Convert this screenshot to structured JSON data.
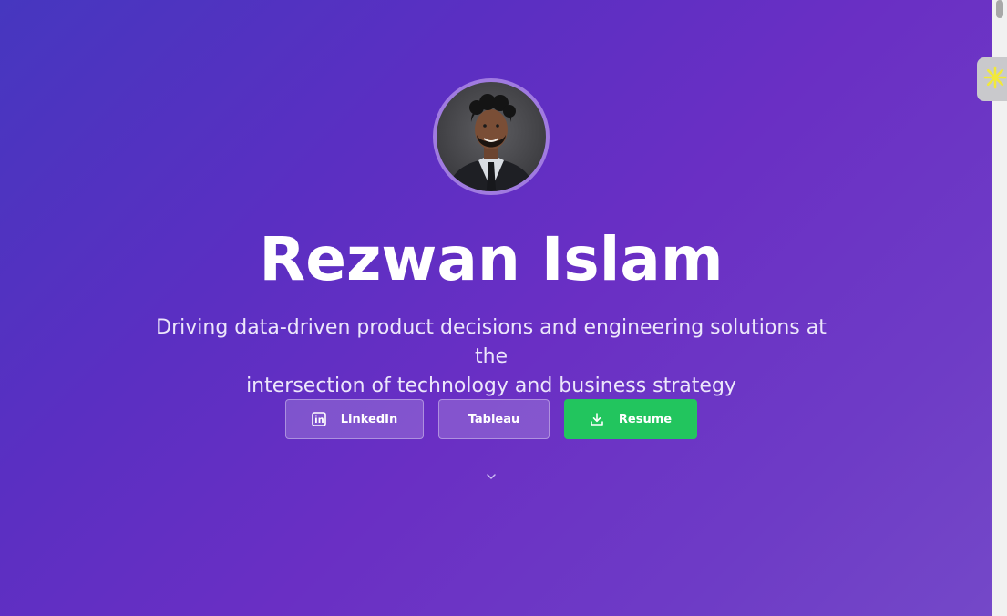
{
  "profile": {
    "name": "Rezwan Islam",
    "tagline_line1": "Driving data-driven product decisions and engineering solutions at the",
    "tagline_line2": "intersection of technology and business strategy",
    "avatar_alt": "profile-photo"
  },
  "buttons": {
    "linkedin": {
      "label": "LinkedIn",
      "icon": "linkedin-icon"
    },
    "tableau": {
      "label": "Tableau"
    },
    "resume": {
      "label": "Resume",
      "icon": "download-icon"
    }
  },
  "scroll_hint": {
    "icon": "chevron-down-icon"
  },
  "colors": {
    "gradient_start": "#4637bf",
    "gradient_end": "#7448c8",
    "resume_green": "#22c55e",
    "avatar_ring": "#a07be0"
  },
  "extension_widget": {
    "icon": "asterisk-sparkle-icon"
  }
}
